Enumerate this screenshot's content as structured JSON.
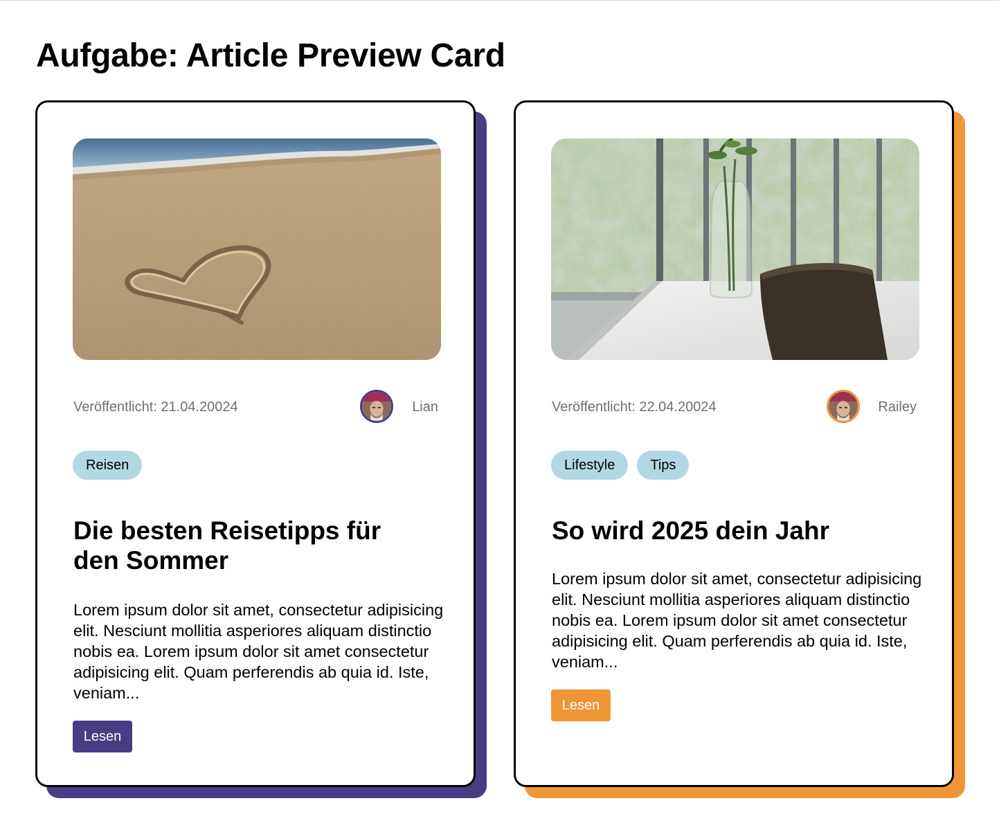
{
  "page": {
    "title": "Aufgabe: Article Preview Card"
  },
  "colors": {
    "accent_purple": "#463d85",
    "accent_orange": "#f19637",
    "tag_background": "#b2d8e4",
    "meta_text": "#6f6f6f"
  },
  "cards": [
    {
      "image": "heart-in-sand-photo",
      "published": "Veröffentlicht: 21.04.20024",
      "author": "Lian",
      "avatar": "author-avatar-photo",
      "tags": [
        "Reisen"
      ],
      "title": "Die besten Reisetipps für den Sommer",
      "body": "Lorem ipsum dolor sit amet, consectetur adipisicing elit. Nesciunt mollitia asperiores aliquam distinctio nobis ea. Lorem ipsum dolor sit amet consectetur adipisicing elit. Quam perferendis ab quia id. Iste, veniam...",
      "button_label": "Lesen",
      "accent": "#463d85"
    },
    {
      "image": "vase-on-table-photo",
      "published": "Veröffentlicht: 22.04.20024",
      "author": "Railey",
      "avatar": "author-avatar-photo",
      "tags": [
        "Lifestyle",
        "Tips"
      ],
      "title": "So wird 2025 dein Jahr",
      "body": "Lorem ipsum dolor sit amet, consectetur adipisicing elit. Nesciunt mollitia asperiores aliquam distinctio nobis ea. Lorem ipsum dolor sit amet consectetur adipisicing elit. Quam perferendis ab quia id. Iste, veniam...",
      "button_label": "Lesen",
      "accent": "#f19637"
    }
  ]
}
